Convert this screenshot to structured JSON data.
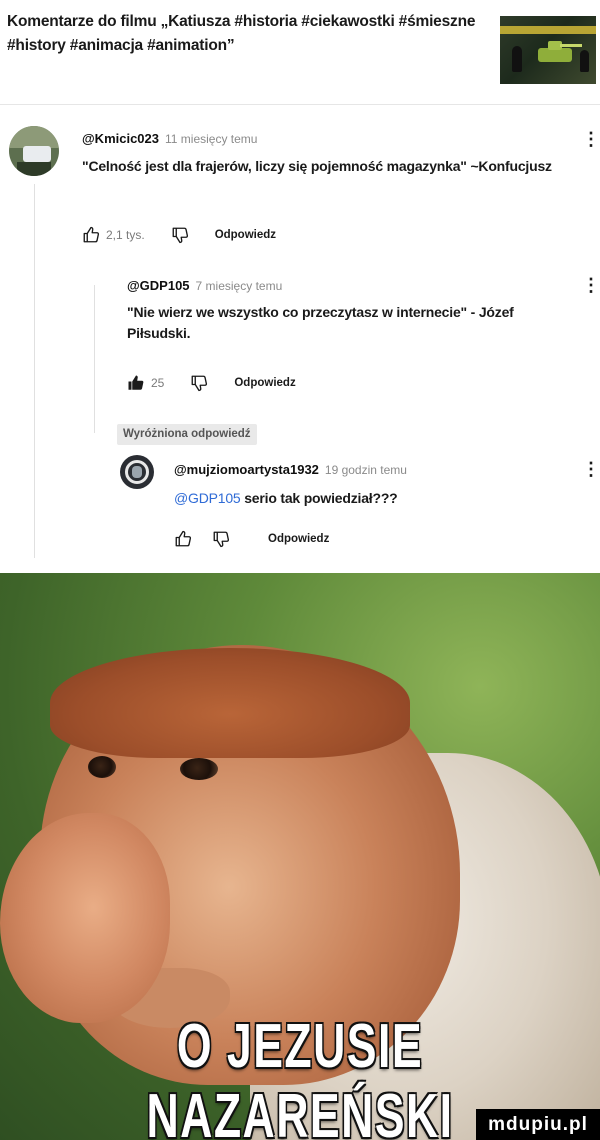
{
  "video": {
    "title": "Komentarze do filmu „Katiusza #historia #ciekawostki #śmieszne #history #animacja #animation”",
    "thumbnail_icon": "video-thumbnail-image"
  },
  "comments": [
    {
      "handle": "@Kmicic023",
      "time": "11 miesięcy temu",
      "text": "\"Celność jest dla frajerów, liczy się pojemność magazynka\" ~Konfucjusz",
      "likes": "2,1 tys.",
      "reply_label": "Odpowiedz",
      "menu_icon": "kebab-menu-icon"
    },
    {
      "handle": "@GDP105",
      "time": "7 miesięcy temu",
      "text": "\"Nie wierz we wszystko co przeczytasz w internecie\" - Józef Piłsudski.",
      "likes": "25",
      "reply_label": "Odpowiedz",
      "menu_icon": "kebab-menu-icon"
    },
    {
      "badge": "Wyróżniona odpowiedź",
      "handle": "@mujziomoartysta1932",
      "time": "19 godzin temu",
      "mention": "@GDP105",
      "text": "serio tak powiedział???",
      "reply_label": "Odpowiedz",
      "menu_icon": "kebab-menu-icon"
    }
  ],
  "meme": {
    "caption": "O JEZUSIE NAZAREŃSKI",
    "watermark": "mdupiu.pl"
  }
}
